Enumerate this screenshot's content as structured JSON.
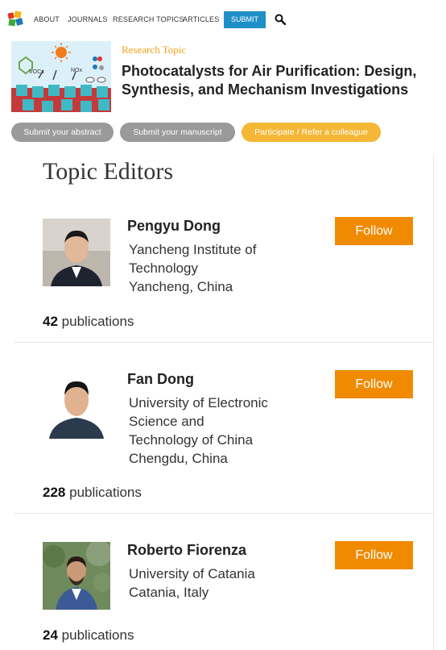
{
  "nav": {
    "items": [
      "ABOUT",
      "JOURNALS",
      "RESEARCH TOPICS",
      "ARTICLES"
    ],
    "submit": "SUBMIT"
  },
  "header": {
    "eyebrow": "Research Topic",
    "title": "Photocatalysts for Air Purification: Design, Synthesis, and Mechanism Investigations",
    "thumbnail_labels": [
      "VOCs",
      "NOx"
    ],
    "actions": [
      "Submit your abstract",
      "Submit your manuscript",
      "Participate / Refer a colleague"
    ]
  },
  "editors_section": {
    "title": "Topic Editors",
    "follow_label": "Follow",
    "publications_word": "publications",
    "editors": [
      {
        "name": "Pengyu Dong",
        "lines": [
          "Yancheng Institute of",
          "Technology",
          "Yancheng, China"
        ],
        "publications": "42"
      },
      {
        "name": "Fan Dong",
        "lines": [
          "University of Electronic",
          "Science and",
          "Technology of China",
          "Chengdu, China"
        ],
        "publications": "228"
      },
      {
        "name": "Roberto Fiorenza",
        "lines": [
          "University of Catania",
          "Catania, Italy"
        ],
        "publications": "24"
      }
    ]
  },
  "colors": {
    "accent_orange": "#f08a00",
    "eyebrow_orange": "#f3a21b",
    "submit_blue": "#1e8fc7",
    "pill_grey": "#9a9a9a",
    "pill_orange": "#f4b736"
  },
  "icons": [
    "frontiers-logo",
    "search-icon"
  ]
}
